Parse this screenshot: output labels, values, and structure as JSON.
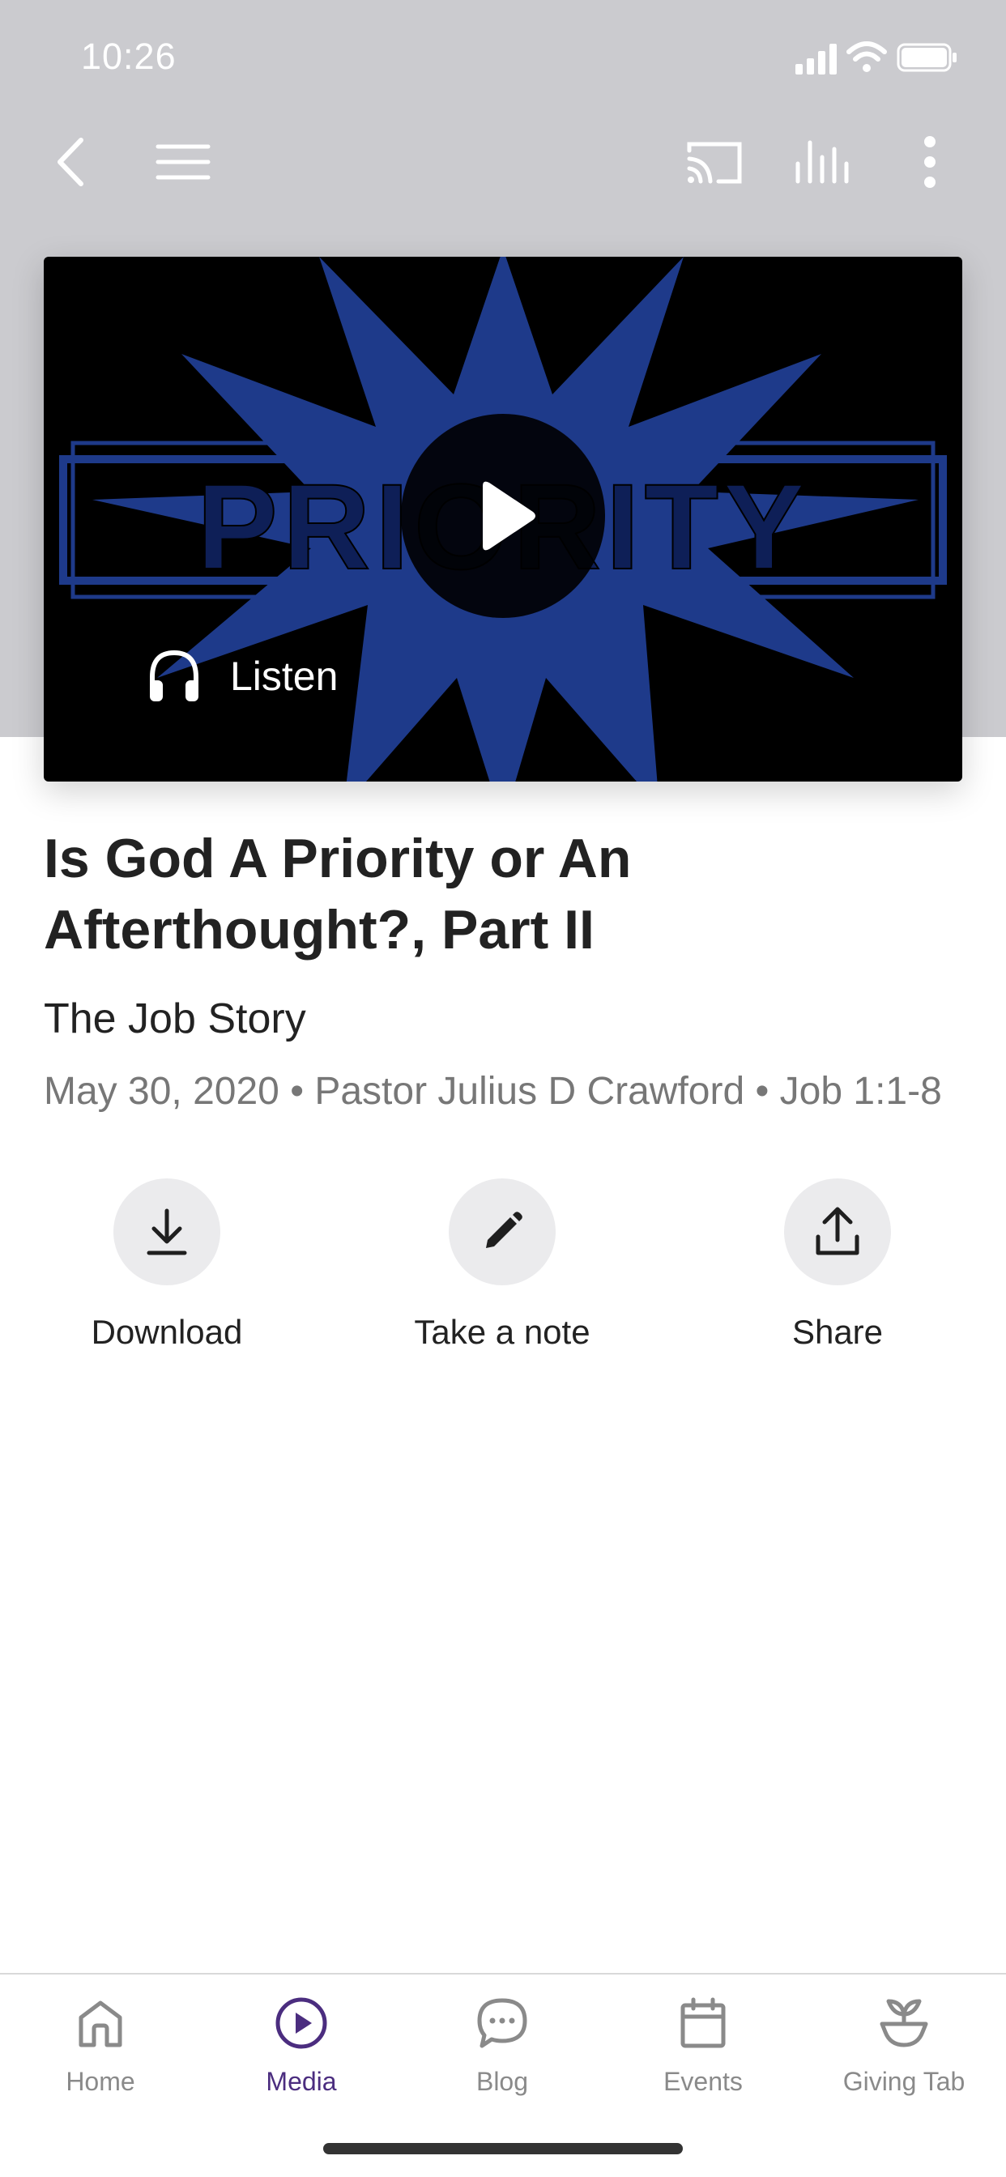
{
  "status_bar": {
    "time": "10:26"
  },
  "nav": {
    "icons": [
      "back-chevron-icon",
      "menu-icon",
      "cast-icon",
      "audio-levels-icon",
      "more-vertical-icon"
    ]
  },
  "hero": {
    "artwork_text": "PRIORITY",
    "listen_label": "Listen",
    "colors": {
      "art_blue": "#1e3a8a",
      "background": "#000000"
    }
  },
  "sermon": {
    "title_line1": "Is God A Priority or An",
    "title_line2": "Afterthought?, Part II",
    "series": "The Job Story",
    "meta": "May 30, 2020 • Pastor Julius D Crawford • Job 1:1-8"
  },
  "actions": [
    {
      "label": "Download",
      "icon": "download-icon"
    },
    {
      "label": "Take a note",
      "icon": "pencil-icon"
    },
    {
      "label": "Share",
      "icon": "share-icon"
    }
  ],
  "tabs": [
    {
      "label": "Home",
      "icon": "home-icon",
      "active": false
    },
    {
      "label": "Media",
      "icon": "play-circle-icon",
      "active": true
    },
    {
      "label": "Blog",
      "icon": "chat-bubble-icon",
      "active": false
    },
    {
      "label": "Events",
      "icon": "calendar-icon",
      "active": false
    },
    {
      "label": "Giving Tab",
      "icon": "plant-pot-icon",
      "active": false
    }
  ],
  "colors": {
    "accent": "#4b2d7f",
    "top_band": "#cbcbcf",
    "muted_text": "#777777"
  }
}
